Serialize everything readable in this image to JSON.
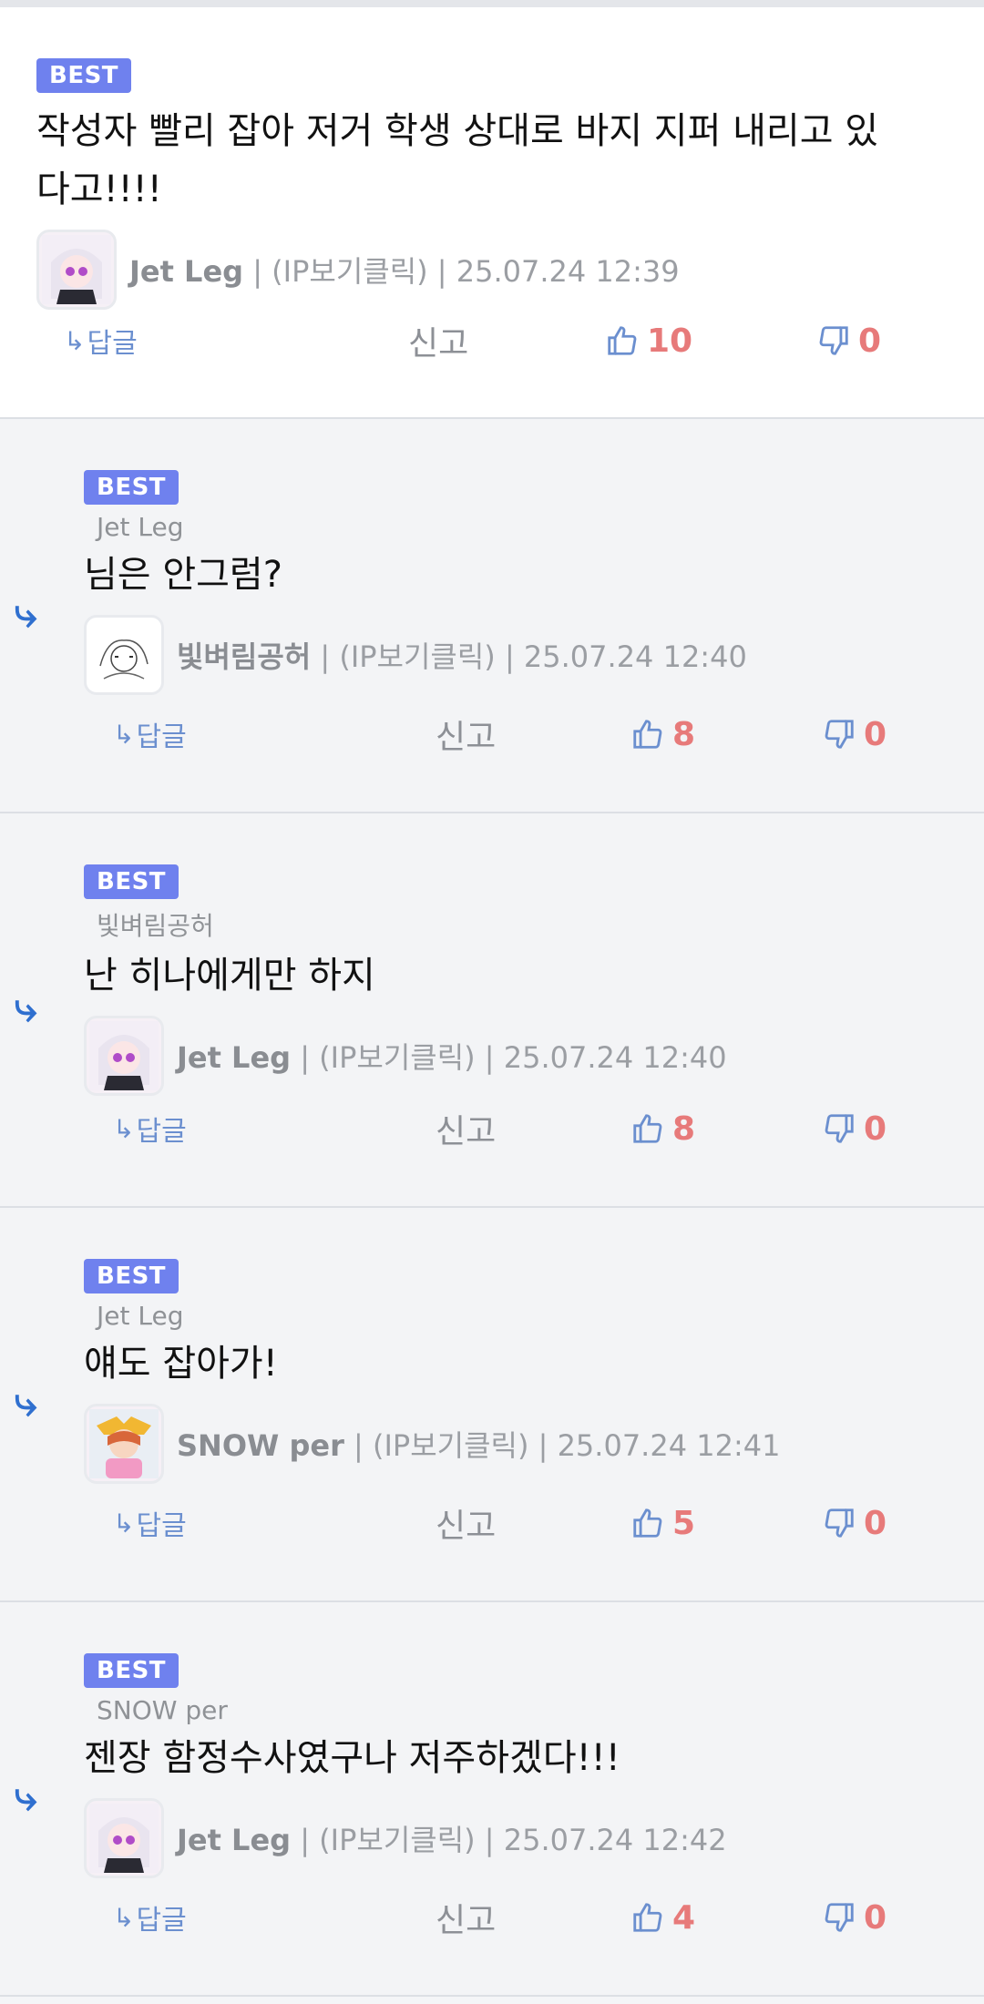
{
  "comments": [
    {
      "badge": "BEST",
      "parent": "",
      "text": "작성자 빨리 잡아 저거 학생 상대로 바지 지퍼 내리고 있다고!!!!",
      "author": "Jet Leg",
      "ip": " | (IP보기클릭) | 25.07.24 12:39",
      "reply_label": "답글",
      "report_label": "신고",
      "likes": "10",
      "dislikes": "0",
      "avatar_icon": "anime-girl-avatar-icon"
    },
    {
      "badge": "BEST",
      "parent": "Jet Leg",
      "text": "님은 안그럼?",
      "author": "빛벼림공허",
      "ip": " | (IP보기클릭) | 25.07.24 12:40",
      "reply_label": "답글",
      "report_label": "신고",
      "likes": "8",
      "dislikes": "0",
      "avatar_icon": "sketch-avatar-icon"
    },
    {
      "badge": "BEST",
      "parent": "빛벼림공허",
      "text": "난 히나에게만 하지",
      "author": "Jet Leg",
      "ip": " | (IP보기클릭) | 25.07.24 12:40",
      "reply_label": "답글",
      "report_label": "신고",
      "likes": "8",
      "dislikes": "0",
      "avatar_icon": "anime-girl-avatar-icon"
    },
    {
      "badge": "BEST",
      "parent": "Jet Leg",
      "text": "얘도 잡아가!",
      "author": "SNOW per",
      "ip": " | (IP보기클릭) | 25.07.24 12:41",
      "reply_label": "답글",
      "report_label": "신고",
      "likes": "5",
      "dislikes": "0",
      "avatar_icon": "orange-hair-avatar-icon"
    },
    {
      "badge": "BEST",
      "parent": "SNOW per",
      "text": "젠장 함정수사였구나 저주하겠다!!!",
      "author": "Jet Leg",
      "ip": " | (IP보기클릭) | 25.07.24 12:42",
      "reply_label": "답글",
      "report_label": "신고",
      "likes": "4",
      "dislikes": "0",
      "avatar_icon": "anime-girl-avatar-icon"
    }
  ],
  "colors": {
    "badge": "#6f81ee",
    "like_count": "#e77a7a",
    "reply_arrow": "#2f6fcf"
  }
}
